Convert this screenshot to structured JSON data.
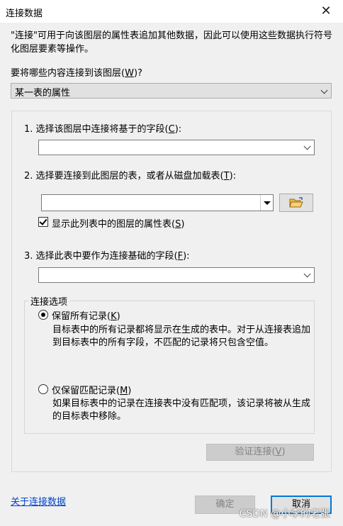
{
  "window": {
    "title": "连接数据"
  },
  "intro": "\"连接\"可用于向该图层的属性表追加其他数据，因此可以使用这些数据执行符号化图层要素等操作。",
  "join_what": {
    "label": "要将哪些内容连接到该图层(",
    "mnemonic": "W",
    "label_end": ")?",
    "selected": "某一表的属性"
  },
  "step1": {
    "label": "1. 选择该图层中连接将基于的字段(",
    "mnemonic": "C",
    "label_end": "):",
    "value": ""
  },
  "step2": {
    "label": "2. 选择要连接到此图层的表，或者从磁盘加载表(",
    "mnemonic": "T",
    "label_end": "):",
    "value": "",
    "browse_icon": "folder-open-icon"
  },
  "show_layers_checkbox": {
    "label": "显示此列表中的图层的属性表(",
    "mnemonic": "S",
    "label_end": ")",
    "checked": true
  },
  "step3": {
    "label": "3. 选择此表中要作为连接基础的字段(",
    "mnemonic": "F",
    "label_end": "):",
    "value": ""
  },
  "join_options": {
    "legend": "连接选项",
    "keep_all": {
      "label": "保留所有记录(",
      "mnemonic": "K",
      "label_end": ")",
      "checked": true,
      "description": "目标表中的所有记录都将显示在生成的表中。对于从连接表追加到目标表中的所有字段，不匹配的记录将只包含空值。"
    },
    "keep_matching": {
      "label": "仅保留匹配记录(",
      "mnemonic": "M",
      "label_end": ")",
      "checked": false,
      "description": "如果目标表中的记录在连接表中没有匹配项，该记录将被从生成的目标表中移除。"
    }
  },
  "validate_button": {
    "label": "验证连接(",
    "mnemonic": "V",
    "label_end": ")"
  },
  "about_link": "关于连接数据",
  "ok_button": "确定",
  "cancel_button": "取消",
  "watermark": "CSDN @小李的老张"
}
